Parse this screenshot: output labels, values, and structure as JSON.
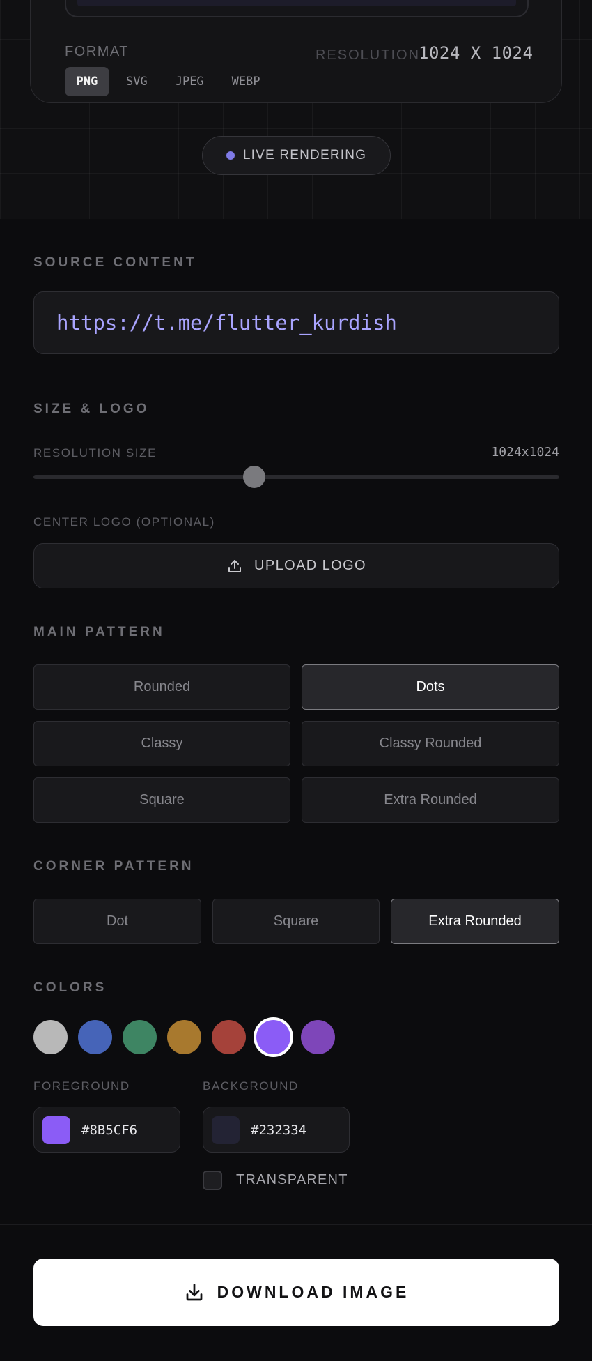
{
  "preview": {
    "format_label": "FORMAT",
    "formats": [
      "PNG",
      "SVG",
      "JPEG",
      "WEBP"
    ],
    "active_format": "PNG",
    "resolution_label": "RESOLUTION",
    "resolution_value": "1024 X 1024",
    "live_label": "LIVE RENDERING"
  },
  "source": {
    "title": "SOURCE CONTENT",
    "value": "https://t.me/flutter_kurdish"
  },
  "size_logo": {
    "title": "SIZE & LOGO",
    "resolution_label": "RESOLUTION SIZE",
    "resolution_value": "1024x1024",
    "slider_fraction": 0.42,
    "logo_label": "CENTER LOGO (OPTIONAL)",
    "upload_label": "UPLOAD LOGO"
  },
  "main_pattern": {
    "title": "MAIN PATTERN",
    "options": [
      "Rounded",
      "Dots",
      "Classy",
      "Classy Rounded",
      "Square",
      "Extra Rounded"
    ],
    "selected": "Dots"
  },
  "corner_pattern": {
    "title": "CORNER PATTERN",
    "options": [
      "Dot",
      "Square",
      "Extra Rounded"
    ],
    "selected": "Extra Rounded"
  },
  "colors": {
    "title": "COLORS",
    "swatches": [
      "#B8B8B8",
      "#4664B8",
      "#3E8563",
      "#A8792E",
      "#A5423A",
      "#8B5CF6",
      "#7E46B9"
    ],
    "selected_swatch": "#8B5CF6",
    "foreground_label": "FOREGROUND",
    "foreground_value": "#8B5CF6",
    "background_label": "BACKGROUND",
    "background_value": "#232334",
    "transparent_label": "TRANSPARENT",
    "transparent_checked": false
  },
  "download": {
    "label": "DOWNLOAD IMAGE"
  },
  "icons": [
    "upload-icon",
    "download-icon"
  ]
}
